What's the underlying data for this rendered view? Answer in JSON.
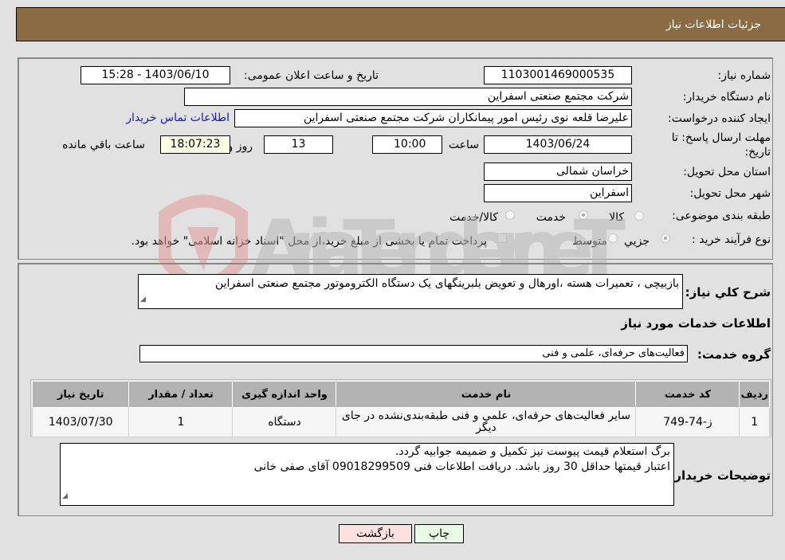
{
  "header": {
    "title": "جزئیات اطلاعات نیاز"
  },
  "fields": {
    "need_number": {
      "label": "شماره نیاز:",
      "value": "1103001469000535"
    },
    "announce_datetime": {
      "label": "تاریخ و ساعت اعلان عمومی:",
      "value": "1403/06/10 - 15:28"
    },
    "buyer_org": {
      "label": "نام دستگاه خریدار:",
      "value": "شرکت مجتمع صنعتی اسفراین"
    },
    "requester": {
      "label": "ایجاد کننده درخواست:",
      "value": "علیرضا قلعه نوی رئیس امور پیمانکاران شرکت مجتمع صنعتی اسفراین"
    },
    "buyer_contact_link": "اطلاعات تماس خریدار",
    "deadline": {
      "label_line1": "مهلت ارسال پاسخ: تا",
      "label_line2": "تاریخ:",
      "date": "1403/06/24",
      "time_label": "ساعت",
      "time": "10:00",
      "days": "13",
      "days_label": "روز و",
      "remaining": "18:07:23",
      "remaining_label": "ساعت باقي مانده"
    },
    "province": {
      "label": "استان محل تحویل:",
      "value": "خراسان شمالی"
    },
    "city": {
      "label": "شهر محل تحویل:",
      "value": "اسفراین"
    },
    "category": {
      "label": "طبقه بندی موضوعی:",
      "options": [
        "کالا",
        "خدمت",
        "کالا/خدمت"
      ],
      "selected": "خدمت"
    },
    "process_type": {
      "label": "نوع فرآیند خرید :",
      "options": [
        "جزيي",
        "متوسط"
      ],
      "selected": "جزيي",
      "treasury_note": "پرداخت تمام یا بخشی از مبلغ خرید،از محل \"اسناد خزانه اسلامی\" خواهد بود."
    }
  },
  "description": {
    "label": "شرح کلي نیاز:",
    "value": "بازبیچی ، تعمیرات هسته ،اورهال و تعویض بلبرینگهای یک دستگاه الکتروموتور مجتمع صنعتی اسفراین"
  },
  "services_section": {
    "title": "اطلاعات خدمات مورد نیاز",
    "group_label": "گروه خدمت:",
    "group_value": "فعالیت‌های حرفه‌ای، علمی و فنی",
    "table": {
      "headers": [
        "ردیف",
        "کد خدمت",
        "نام خدمت",
        "واحد اندازه گیری",
        "تعداد / مقدار",
        "تاریخ نیاز"
      ],
      "rows": [
        [
          "1",
          "ز-74-749",
          "سایر فعالیت‌های حرفه‌ای، علمی و فنی طبقه‌بندی‌نشده در جای دیگر",
          "دستگاه",
          "1",
          "1403/07/30"
        ]
      ]
    }
  },
  "buyer_notes": {
    "label": "توضیحات خریدار:",
    "line1": "برگ استعلام قیمت پیوست نیز تکمیل و ضمیمه جوابیه گردد.",
    "line2": "اعتبار قیمتها حداقل 30 روز باشد. دریافت اطلاعات فنی 09018299509 آقای صفی خانی"
  },
  "buttons": {
    "print": "چاپ",
    "back": "بازگشت"
  },
  "watermark": {
    "text": "AriaTender.neT"
  }
}
